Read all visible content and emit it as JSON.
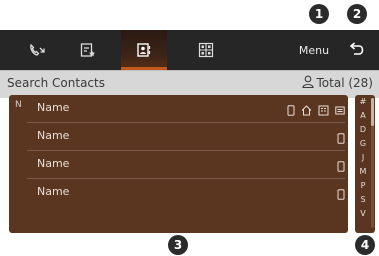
{
  "tabs": [
    {
      "name": "call-log-icon"
    },
    {
      "name": "favorites-icon"
    },
    {
      "name": "contacts-icon"
    },
    {
      "name": "keypad-icon"
    }
  ],
  "header": {
    "menu_label": "Menu"
  },
  "search": {
    "placeholder": "Search Contacts",
    "total_label": "Total (28)"
  },
  "list": {
    "index_letter": "N",
    "rows": [
      {
        "name": "Name"
      },
      {
        "name": "Name"
      },
      {
        "name": "Name"
      },
      {
        "name": "Name"
      }
    ]
  },
  "alpha_index": [
    "#",
    "A",
    "D",
    "G",
    "J",
    "M",
    "P",
    "S",
    "V"
  ],
  "callouts": [
    "1",
    "2",
    "3",
    "4"
  ],
  "colors": {
    "accent": "#c35a1c",
    "list_bg": "#5a3520",
    "tabbar_bg": "#262626",
    "search_bg": "#d7d7d7"
  }
}
